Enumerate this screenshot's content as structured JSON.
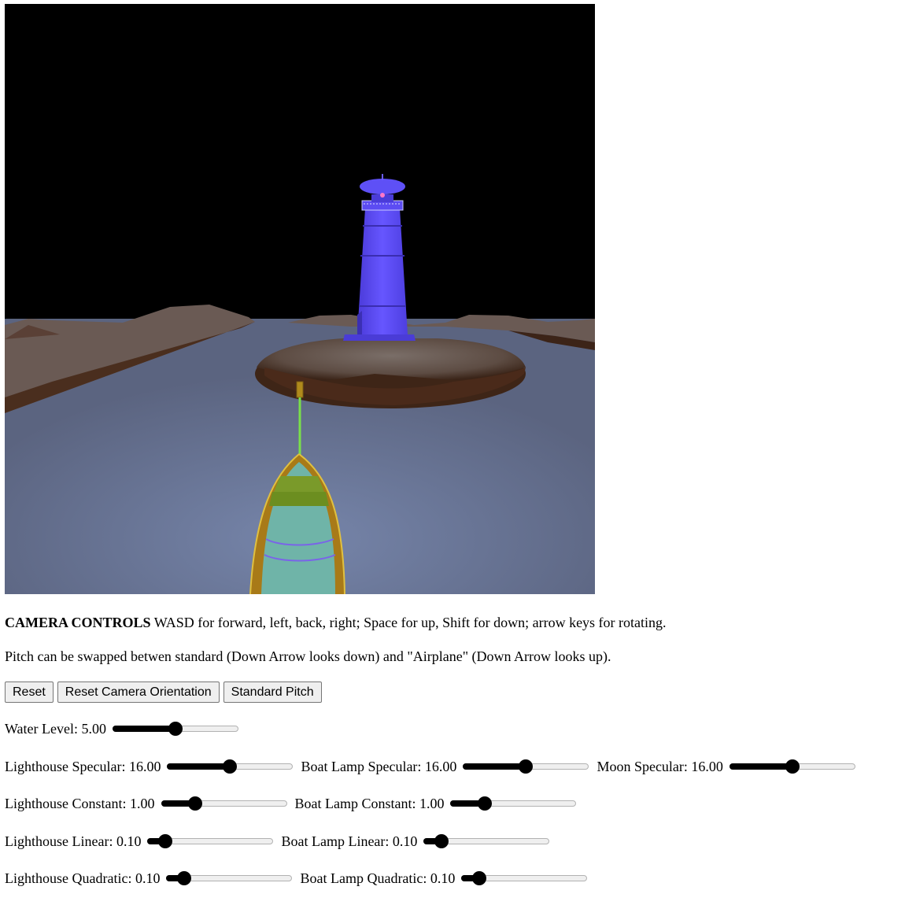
{
  "instructions": {
    "camera_heading": "CAMERA CONTROLS",
    "camera_text": " WASD for forward, left, back, right; Space for up, Shift for down; arrow keys for rotating.",
    "pitch_text": "Pitch can be swapped betwen standard (Down Arrow looks down) and \"Airplane\" (Down Arrow looks up)."
  },
  "buttons": {
    "reset": "Reset",
    "reset_camera": "Reset Camera Orientation",
    "standard_pitch": "Standard Pitch"
  },
  "sliders": {
    "water_level": {
      "label": "Water Level: 5.00",
      "fraction": 0.5
    },
    "lighthouse_specular": {
      "label": "Lighthouse Specular: 16.00",
      "fraction": 0.5
    },
    "boat_lamp_specular": {
      "label": "Boat Lamp Specular: 16.00",
      "fraction": 0.5
    },
    "moon_specular": {
      "label": "Moon Specular: 16.00",
      "fraction": 0.5
    },
    "lighthouse_constant": {
      "label": "Lighthouse Constant: 1.00",
      "fraction": 0.27
    },
    "boat_lamp_constant": {
      "label": "Boat Lamp Constant: 1.00",
      "fraction": 0.27
    },
    "lighthouse_linear": {
      "label": "Lighthouse Linear: 0.10",
      "fraction": 0.14
    },
    "boat_lamp_linear": {
      "label": "Boat Lamp Linear: 0.10",
      "fraction": 0.14
    },
    "lighthouse_quadratic": {
      "label": "Lighthouse Quadratic: 0.10",
      "fraction": 0.14
    },
    "boat_lamp_quadratic": {
      "label": "Boat Lamp Quadratic: 0.10",
      "fraction": 0.14
    }
  },
  "colors": {
    "sky": "#000000",
    "water": "#5f6a86",
    "lighthouse": "#5b4cf0",
    "sand": "#6c5a52",
    "boat_beam": "#7ae04a"
  }
}
